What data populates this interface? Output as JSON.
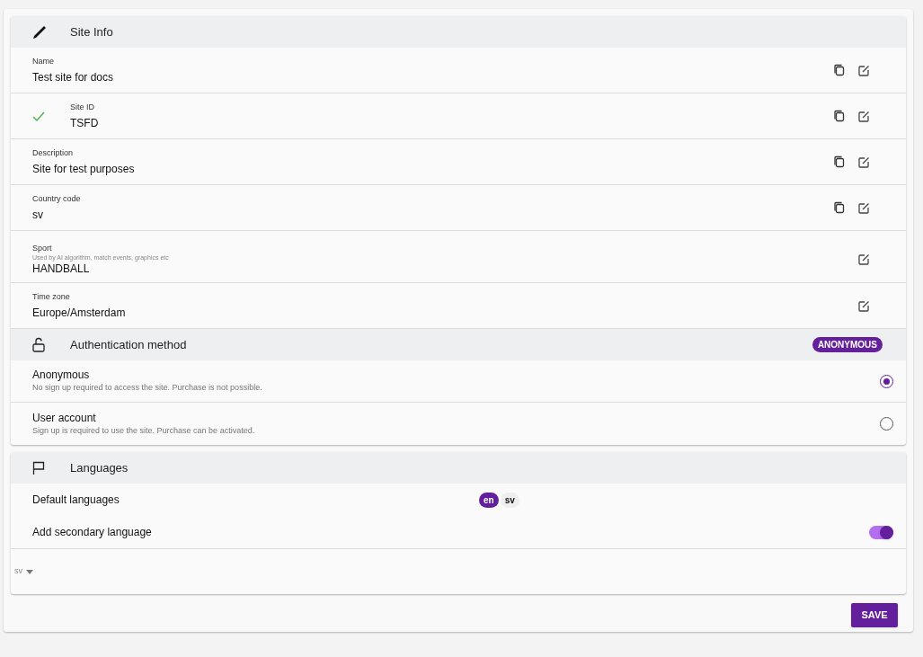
{
  "site_info": {
    "title": "Site Info",
    "fields": [
      {
        "label": "Name",
        "value": "Test site for docs",
        "verified": false,
        "copyable": true
      },
      {
        "label": "Site ID",
        "value": "TSFD",
        "verified": true,
        "copyable": true
      },
      {
        "label": "Description",
        "value": "Site for test purposes",
        "verified": false,
        "copyable": true
      },
      {
        "label": "Country code",
        "value": "sv",
        "verified": false,
        "copyable": true
      },
      {
        "label": "Sport",
        "hint": "Used by AI algorithm, match events, graphics etc",
        "value": "HANDBALL",
        "verified": false,
        "copyable": false
      },
      {
        "label": "Time zone",
        "value": "Europe/Amsterdam",
        "verified": false,
        "copyable": false
      }
    ]
  },
  "authentication": {
    "title": "Authentication method",
    "badge": "ANONYMOUS",
    "options": [
      {
        "label": "Anonymous",
        "description": "No sign up required to access the site. Purchase is not possible.",
        "selected": true
      },
      {
        "label": "User account",
        "description": "Sign up is required to use the site. Purchase can be activated.",
        "selected": false
      }
    ]
  },
  "languages": {
    "title": "Languages",
    "default_label": "Default languages",
    "chips": [
      {
        "label": "en",
        "selected": true
      },
      {
        "label": "sv",
        "selected": false
      }
    ],
    "secondary_label": "Add secondary language",
    "secondary_on": true,
    "select": {
      "value": "sv"
    }
  },
  "save_button": "SAVE"
}
